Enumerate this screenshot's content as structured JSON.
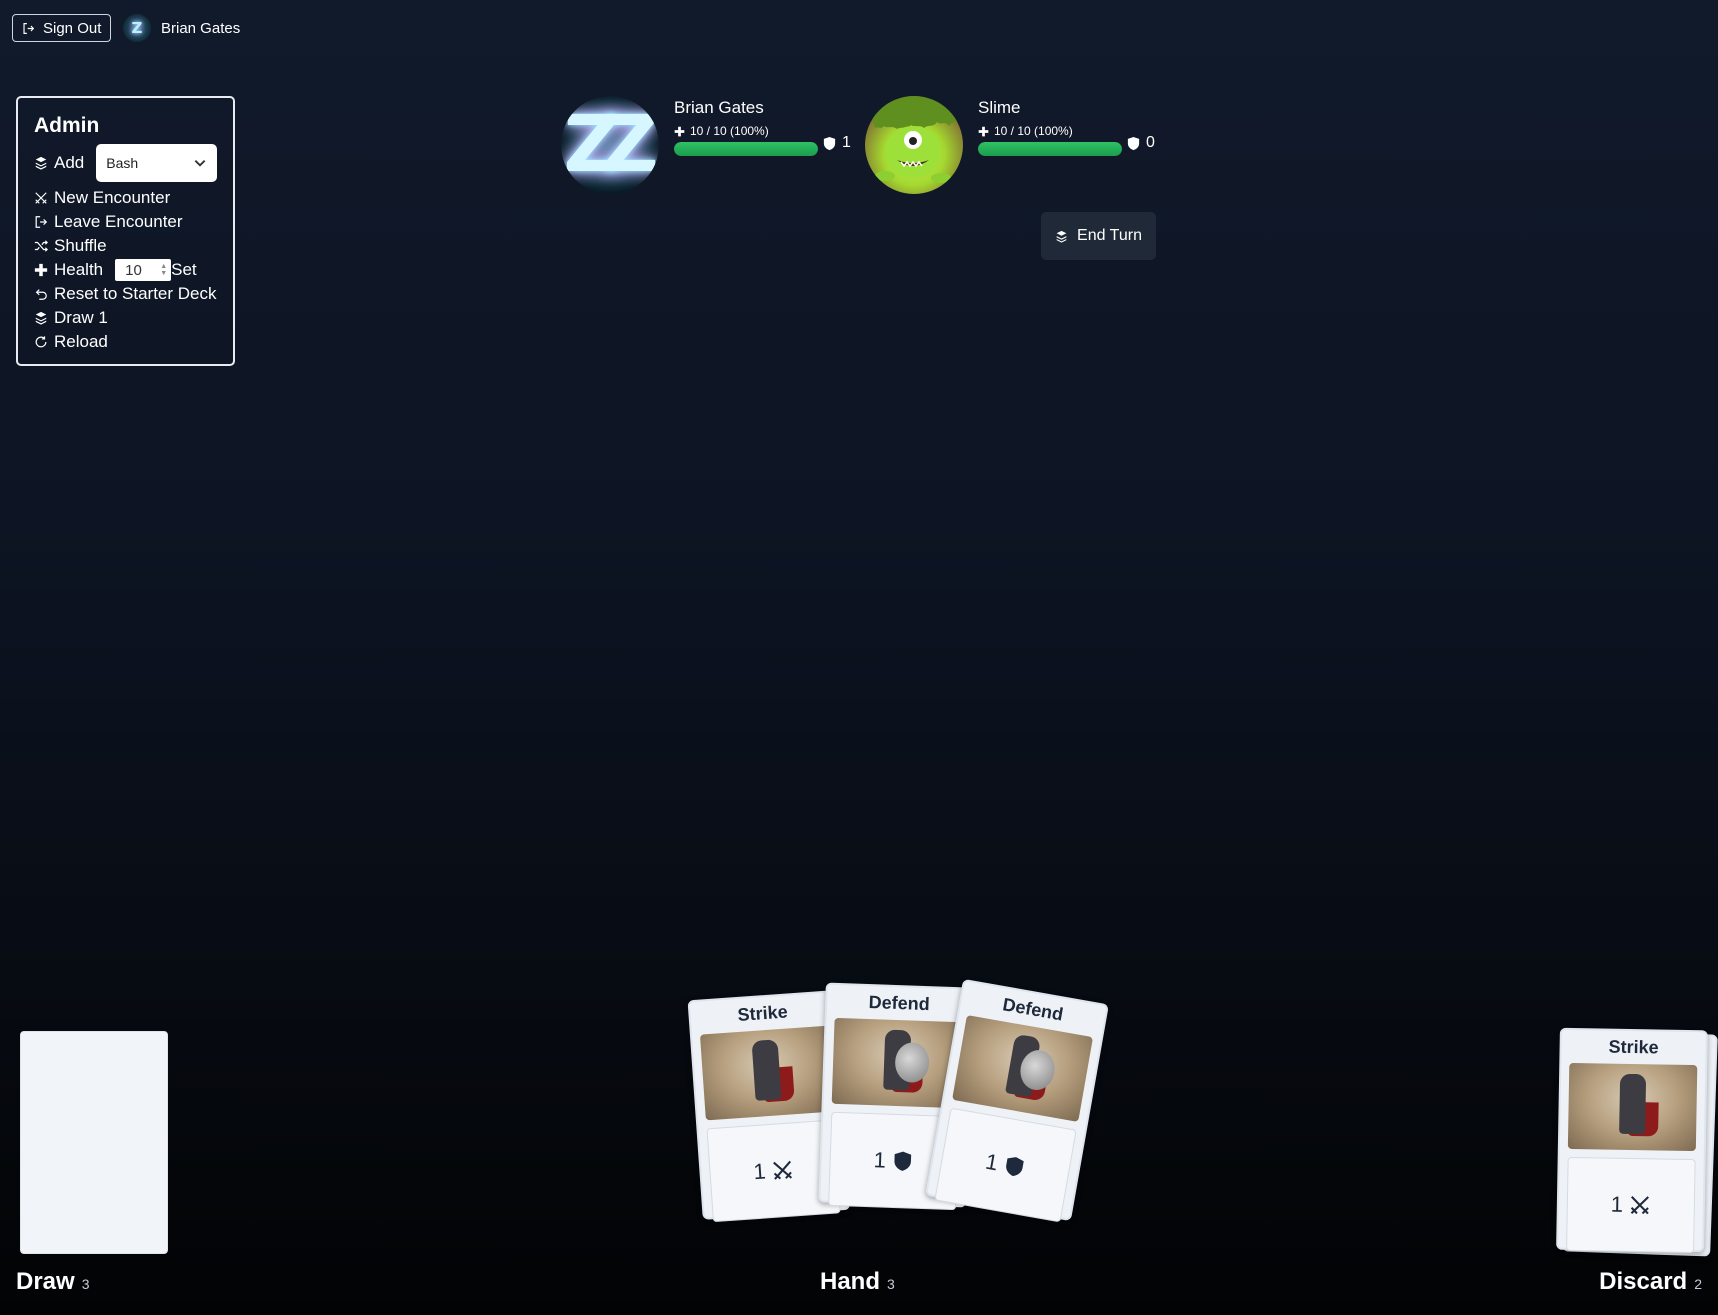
{
  "header": {
    "sign_out_label": "Sign Out",
    "user_name": "Brian Gates",
    "logo_glyph": "Z"
  },
  "admin": {
    "title": "Admin",
    "add_label": "Add",
    "add_select_value": "Bash",
    "new_encounter_label": "New Encounter",
    "leave_encounter_label": "Leave Encounter",
    "shuffle_label": "Shuffle",
    "health_label": "Health",
    "health_value": "10",
    "set_label": "Set",
    "reset_label": "Reset to Starter Deck",
    "draw_label": "Draw 1",
    "reload_label": "Reload"
  },
  "player": {
    "name": "Brian Gates",
    "hp_text": "10 / 10 (100%)",
    "hp_fraction": 1.0,
    "block": "1",
    "portrait_glyph": "ZZ"
  },
  "enemy": {
    "name": "Slime",
    "hp_text": "10 / 10 (100%)",
    "hp_fraction": 1.0,
    "block": "0"
  },
  "end_turn_label": "End Turn",
  "hand": [
    {
      "title": "Strike",
      "cost": "1",
      "type": "attack",
      "icon": "crossed-swords-icon"
    },
    {
      "title": "Defend",
      "cost": "1",
      "type": "defend",
      "icon": "shield-icon"
    },
    {
      "title": "Defend",
      "cost": "1",
      "type": "defend",
      "icon": "shield-icon"
    }
  ],
  "discard_top": {
    "title": "Strike",
    "cost": "1",
    "type": "attack",
    "icon": "crossed-swords-icon"
  },
  "piles": {
    "draw_label": "Draw",
    "draw_count": "3",
    "hand_label": "Hand",
    "hand_count": "3",
    "discard_label": "Discard",
    "discard_count": "2"
  },
  "colors": {
    "health_bar": "#22a85a",
    "button_bg": "#1f2937",
    "card_bg": "#eef2f7"
  }
}
